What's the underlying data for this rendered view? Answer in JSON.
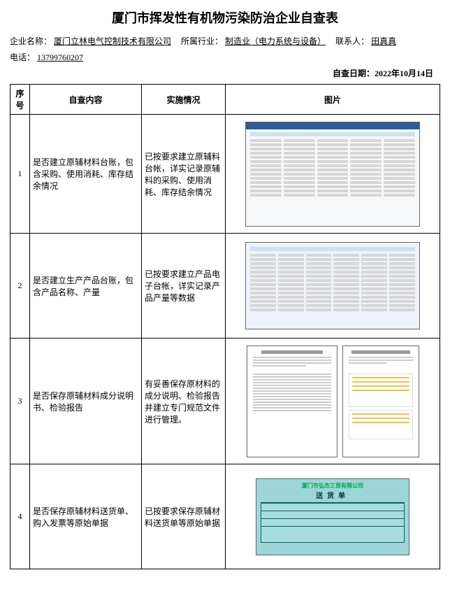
{
  "title": "厦门市挥发性有机物污染防治企业自查表",
  "meta": {
    "company_label": "企业名称：",
    "company_value": "厦门立林电气控制技术有限公司",
    "industry_label": "所属行业：",
    "industry_value": "制造业（电力系统与设备）",
    "contact_label": "联系人：",
    "contact_value": "田真真",
    "phone_label": "电话：",
    "phone_value": "13799760207",
    "date_label": "自查日期：",
    "date_value": "2022年10月14日"
  },
  "headers": {
    "seq": "序号",
    "content": "自查内容",
    "impl": "实施情况",
    "pic": "图片"
  },
  "rows": [
    {
      "seq": "1",
      "content": "是否建立原辅材料台账，包含采购、使用消耗、库存结余情况",
      "impl": "已按要求建立原辅料台帐，详实记录原辅料的采购、使用消耗、库存结余情况"
    },
    {
      "seq": "2",
      "content": "是否建立生产产品台账，包含产品名称、产量",
      "impl": "已按要求建立产品电子台帐，详实记录产品产量等数据"
    },
    {
      "seq": "3",
      "content": "是否保存原辅材料成分说明书、检验报告",
      "impl": "有妥善保存原材料的成分说明、检验报告并建立专门规范文件进行管理。"
    },
    {
      "seq": "4",
      "content": "是否保存原辅材料送货单、购入发票等原始单据",
      "impl": "已按要求保存原辅材料送货单等原始单据"
    }
  ],
  "receipt": {
    "company": "厦门市弘杰工贸有限公司",
    "title": "送货单"
  }
}
